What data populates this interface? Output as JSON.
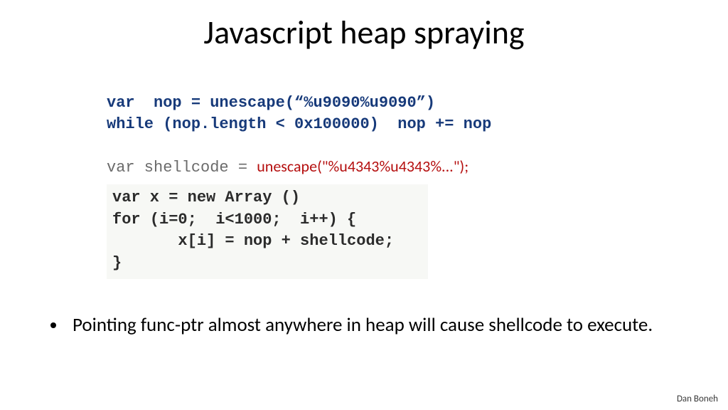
{
  "title": "Javascript heap spraying",
  "code": {
    "l1": "var  nop = unescape(“%u9090%u9090”)",
    "l2": "while (nop.length < 0x100000)  nop += nop",
    "l3a": "var shellcode = ",
    "l3b": "unescape(\"%u4343%u4343%...\");",
    "box": "var x = new Array ()\nfor (i=0;  i<1000;  i++) {\n       x[i] = nop + shellcode;\n}"
  },
  "bullet1": "Pointing  func-ptr  almost anywhere in heap will cause shellcode to execute.",
  "footer": "Dan Boneh"
}
